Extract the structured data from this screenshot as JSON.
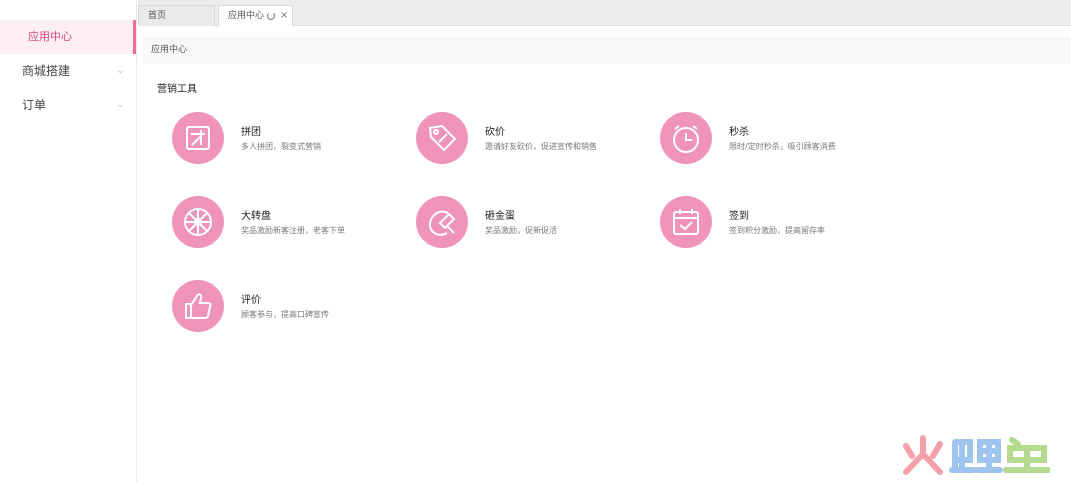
{
  "sidebar": {
    "items": [
      {
        "label": "应用中心"
      },
      {
        "label": "商城搭建"
      },
      {
        "label": "订单"
      }
    ]
  },
  "tabs": [
    {
      "label": "首页"
    },
    {
      "label": "应用中心"
    }
  ],
  "breadcrumb": "应用中心",
  "section": {
    "title": "营销工具"
  },
  "tools": [
    {
      "name": "拼团",
      "desc": "多人拼团，裂变式营销",
      "icon": "group-tuan-icon"
    },
    {
      "name": "砍价",
      "desc": "邀请好友砍价，促进宣传和销售",
      "icon": "price-tag-icon"
    },
    {
      "name": "秒杀",
      "desc": "限时/定时秒杀，吸引顾客消费",
      "icon": "alarm-clock-icon"
    },
    {
      "name": "大转盘",
      "desc": "奖品激励新客注册，老客下单",
      "icon": "wheel-icon"
    },
    {
      "name": "砸金蛋",
      "desc": "奖品激励，促新促活",
      "icon": "hammer-egg-icon"
    },
    {
      "name": "签到",
      "desc": "签到积分激励，提高留存率",
      "icon": "calendar-check-icon"
    },
    {
      "name": "评价",
      "desc": "顾客参与，提高口碑宣传",
      "icon": "thumbs-up-icon"
    }
  ],
  "colors": {
    "accent": "#ef93b9",
    "active_text": "#e2467a"
  }
}
